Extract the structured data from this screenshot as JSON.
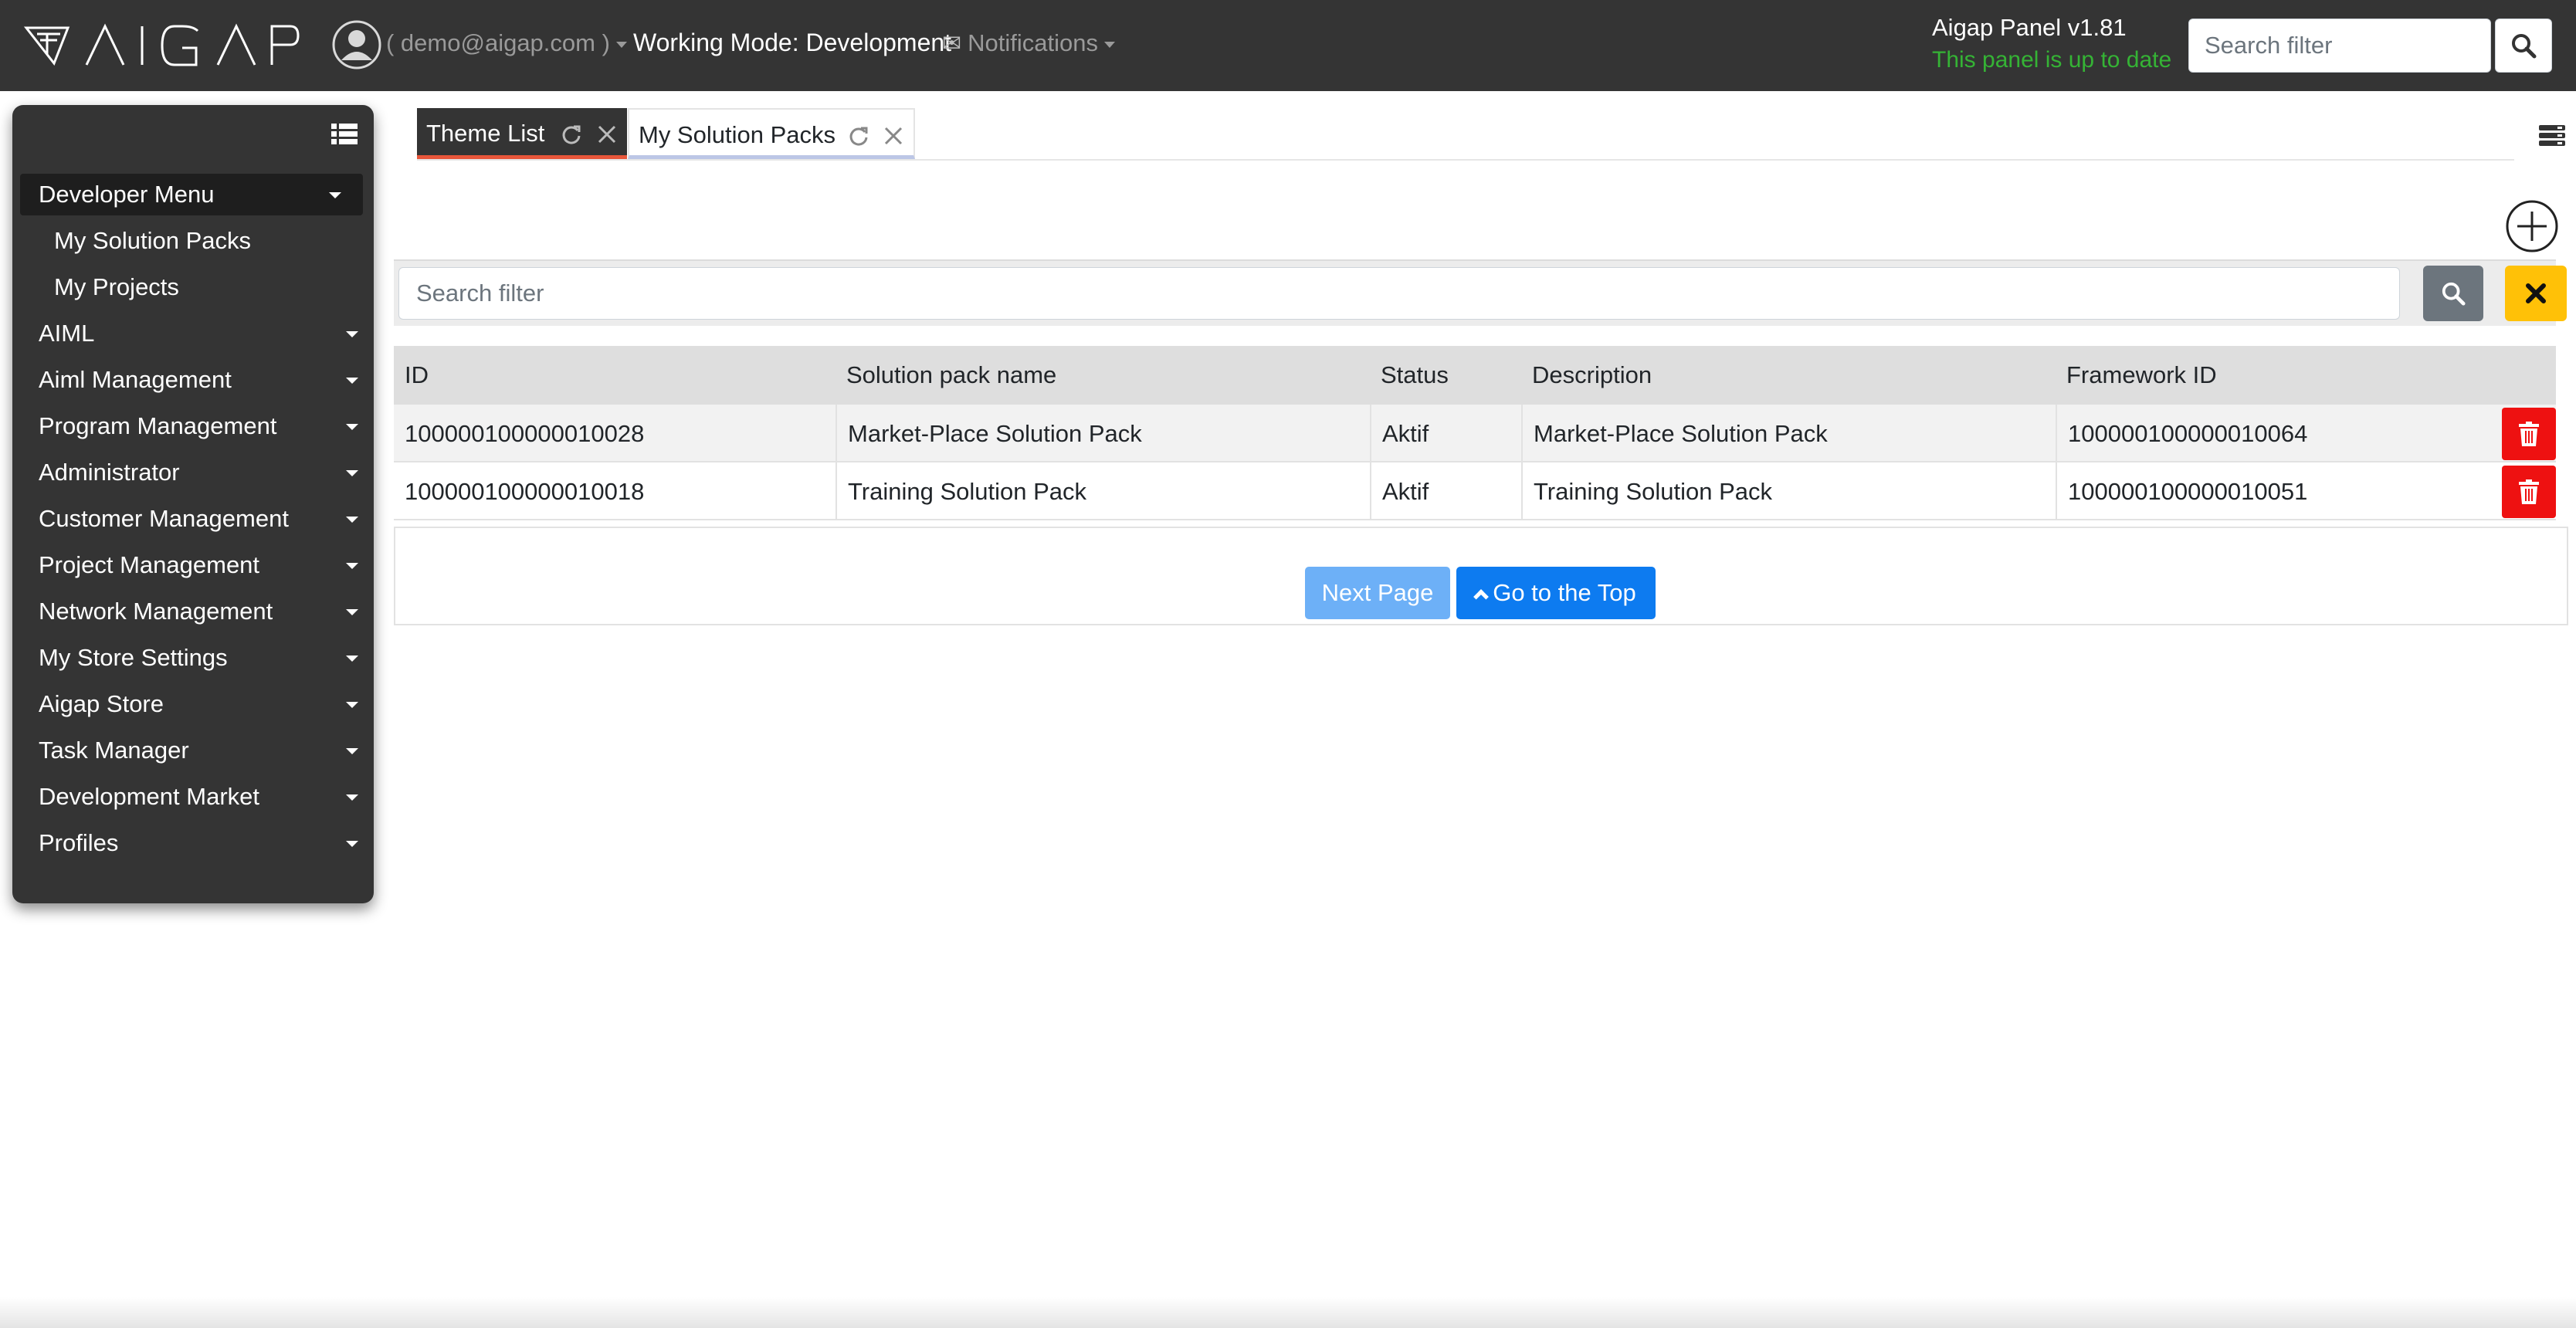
{
  "header": {
    "logo_text": "AIGAP",
    "user_email": "( demo@aigap.com )",
    "working_mode": "Working Mode: Development",
    "notifications_label": "Notifications",
    "panel_version": "Aigap Panel v1.81",
    "panel_status": "This panel is up to date",
    "search_placeholder": "Search filter",
    "status_color": "#35b335"
  },
  "sidebar": {
    "items": [
      {
        "label": "Developer Menu",
        "expandable": true,
        "active": true
      },
      {
        "label": "My Solution Packs",
        "expandable": false,
        "sub": true
      },
      {
        "label": "My Projects",
        "expandable": false,
        "sub": true
      },
      {
        "label": "AIML",
        "expandable": true
      },
      {
        "label": "Aiml Management",
        "expandable": true
      },
      {
        "label": "Program Management",
        "expandable": true
      },
      {
        "label": "Administrator",
        "expandable": true
      },
      {
        "label": "Customer Management",
        "expandable": true
      },
      {
        "label": "Project Management",
        "expandable": true
      },
      {
        "label": "Network Management",
        "expandable": true
      },
      {
        "label": "My Store Settings",
        "expandable": true
      },
      {
        "label": "Aigap Store",
        "expandable": true
      },
      {
        "label": "Task Manager",
        "expandable": true
      },
      {
        "label": "Development Market",
        "expandable": true
      },
      {
        "label": "Profiles",
        "expandable": true
      }
    ]
  },
  "tabs": [
    {
      "label": "Theme List",
      "active": true
    },
    {
      "label": "My Solution Packs",
      "active": false
    }
  ],
  "filter": {
    "placeholder": "Search filter"
  },
  "table": {
    "columns": [
      "ID",
      "Solution pack name",
      "Status",
      "Description",
      "Framework ID"
    ],
    "rows": [
      [
        "100000100000010028",
        "Market-Place Solution Pack",
        "Aktif",
        "Market-Place Solution Pack",
        "100000100000010064"
      ],
      [
        "100000100000010018",
        "Training Solution Pack",
        "Aktif",
        "Training Solution Pack",
        "100000100000010051"
      ]
    ]
  },
  "pager": {
    "next_label": "Next Page",
    "top_label": "Go to the Top"
  },
  "colors": {
    "topbar": "#343434",
    "active_tab_underline": "#e8563a",
    "delete": "#ee1111",
    "clear": "#ffc107",
    "primary": "#0d7bf0"
  }
}
